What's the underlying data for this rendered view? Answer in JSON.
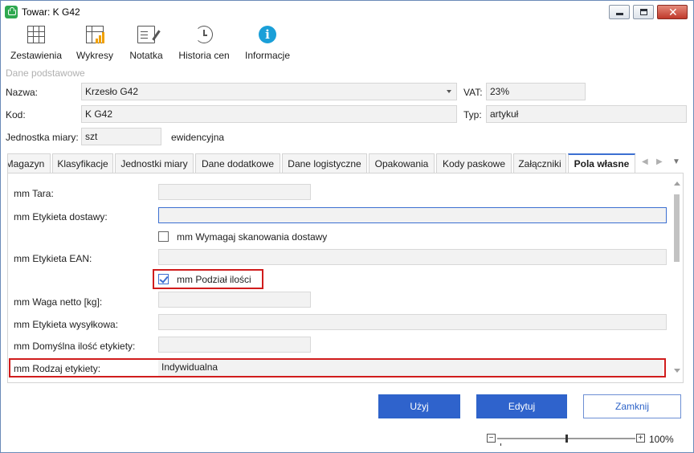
{
  "window": {
    "title": "Towar: K G42",
    "close_glyph": "✕"
  },
  "toolbar": {
    "items": [
      {
        "label": "Zestawienia",
        "icon": "table-icon"
      },
      {
        "label": "Wykresy",
        "icon": "chart-icon"
      },
      {
        "label": "Notatka",
        "icon": "note-icon"
      },
      {
        "label": "Historia cen",
        "icon": "history-icon"
      },
      {
        "label": "Informacje",
        "icon": "info-icon",
        "glyph": "i"
      }
    ]
  },
  "section": {
    "label": "Dane podstawowe"
  },
  "basic": {
    "name_label": "Nazwa:",
    "name_value": "Krzesło G42",
    "vat_label": "VAT:",
    "vat_value": "23%",
    "code_label": "Kod:",
    "code_value": "K G42",
    "type_label": "Typ:",
    "type_value": "artykuł",
    "unit_label": "Jednostka miary:",
    "unit_value": "szt",
    "unit_note": "ewidencyjna"
  },
  "tabs": [
    {
      "label": "Magazyn"
    },
    {
      "label": "Klasyfikacje"
    },
    {
      "label": "Jednostki miary"
    },
    {
      "label": "Dane dodatkowe"
    },
    {
      "label": "Dane logistyczne"
    },
    {
      "label": "Opakowania"
    },
    {
      "label": "Kody paskowe"
    },
    {
      "label": "Załączniki"
    },
    {
      "label": "Pola własne",
      "active": true
    }
  ],
  "custom_fields": {
    "tara_label": "mm Tara:",
    "tara_value": "",
    "etykieta_dostawy_label": "mm Etykieta dostawy:",
    "etykieta_dostawy_value": "",
    "wymagaj_label": "mm Wymagaj skanowania dostawy",
    "wymagaj_checked": false,
    "ean_label": "mm Etykieta EAN:",
    "ean_value": "",
    "podzial_label": "mm Podział ilości",
    "podzial_checked": true,
    "waga_label": "mm Waga netto [kg]:",
    "waga_value": "",
    "wysylkowa_label": "mm Etykieta wysyłkowa:",
    "wysylkowa_value": "",
    "domyslna_label": "mm Domyślna ilość etykiety:",
    "domyslna_value": "",
    "rodzaj_label": "mm Rodzaj etykiety:",
    "rodzaj_value": "Indywidualna"
  },
  "buttons": {
    "use": "Użyj",
    "edit": "Edytuj",
    "close": "Zamknij"
  },
  "zoom": {
    "value": "100%",
    "minus": "−",
    "plus": "+"
  },
  "colors": {
    "accent": "#2f63cc",
    "highlight": "#d01c1c",
    "info": "#1a9fd8"
  }
}
